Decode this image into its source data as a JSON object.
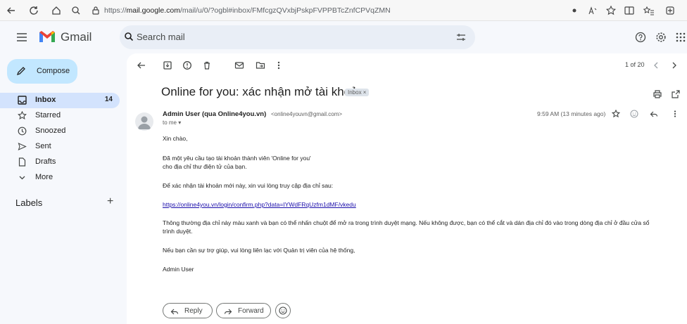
{
  "browser": {
    "url_prefix": "https://",
    "url_domain": "mail.google.com",
    "url_rest": "/mail/u/0/?ogbl#inbox/FMfcgzQVxbjPskpFVPPBTcZnfCPVqZMN"
  },
  "header": {
    "brand": "Gmail",
    "search_placeholder": "Search mail"
  },
  "sidebar": {
    "compose_label": "Compose",
    "items": [
      {
        "label": "Inbox",
        "count": "14",
        "icon": "inbox-icon"
      },
      {
        "label": "Starred",
        "count": "",
        "icon": "star-icon"
      },
      {
        "label": "Snoozed",
        "count": "",
        "icon": "clock-icon"
      },
      {
        "label": "Sent",
        "count": "",
        "icon": "send-icon"
      },
      {
        "label": "Drafts",
        "count": "",
        "icon": "draft-icon"
      },
      {
        "label": "More",
        "count": "",
        "icon": "chevron-down-icon"
      }
    ],
    "labels_title": "Labels",
    "labels_add": "+"
  },
  "toolbar": {
    "pager": "1 of 20"
  },
  "email": {
    "subject": "Online for you: xác nhận mở tài khoản",
    "label_chip": "Inbox ×",
    "sender_name": "Admin User (qua Online4you.vn)",
    "sender_email": "<online4youvn@gmail.com>",
    "to": "to me ▾",
    "timestamp": "9:59 AM (13 minutes ago)",
    "body": {
      "greeting": "Xin chào,",
      "line1": "Đã một yêu cầu tạo tài khoản thành viên 'Online for you'",
      "line2": "cho địa chỉ thư điện tử của bạn.",
      "line3": "Để xác nhận tài khoản mới này, xin vui lòng truy cập địa chỉ sau:",
      "link": "https://online4you.vn/login/confirm.php?data=IYWdFRqUzfm1dMF/vkedu",
      "line4a": "Thông thường địa chỉ này màu xanh và bạn có thể nhấn chuột để mở ra trong trình duyệt mạng. Nếu không được, bạn có thể cắt và dán địa chỉ đó vào trong dòng địa chỉ ở đầu cửa sổ",
      "line4b": "trình duyệt.",
      "line5": "Nếu bạn cần sự trợ giúp, vui lòng liên lạc với Quản trị viên của hệ thống,",
      "signature": "Admin User"
    }
  },
  "actions": {
    "reply_label": "Reply",
    "forward_label": "Forward"
  },
  "colors": {
    "compose_bg": "#c2e7ff",
    "active_nav_bg": "#d3e3fd",
    "link": "#1a0dab"
  }
}
